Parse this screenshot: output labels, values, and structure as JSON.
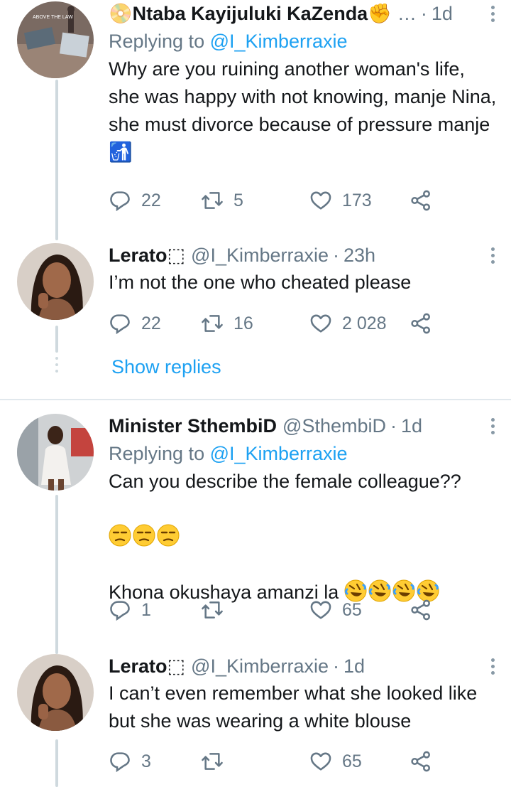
{
  "tweets": [
    {
      "name": "📀Ntaba Kayijuluki KaZenda✊",
      "handle": "…",
      "time": "1d",
      "replying_prefix": "Replying to ",
      "replying_to": "@I_Kimberraxie",
      "text": "Why are you ruining another woman's life, she was happy with not knowing, manje Nina, she must divorce because of pressure manje 🚮",
      "replies": "22",
      "retweets": "5",
      "likes": "173",
      "avatar_caption": "ABOVE THE LAW"
    },
    {
      "name": "Lerato⬚",
      "handle": "@I_Kimberraxie",
      "time": "23h",
      "text": "I’m not the one who cheated please",
      "replies": "22",
      "retweets": "16",
      "likes": "2 028"
    },
    {
      "name": "Minister SthembiD",
      "handle": "@SthembiD",
      "time": "1d",
      "replying_prefix": "Replying to ",
      "replying_to": "@I_Kimberraxie",
      "text_line1": "Can you describe the female colleague??",
      "text_line2": "Khona okushaya amanzi la",
      "replies": "1",
      "retweets": "",
      "likes": "65"
    },
    {
      "name": "Lerato⬚",
      "handle": "@I_Kimberraxie",
      "time": "1d",
      "text": "I can’t even remember what she looked like but she was wearing a white blouse",
      "replies": "3",
      "retweets": "",
      "likes": "65"
    }
  ],
  "show_replies": "Show replies",
  "icons": [
    "reply-icon",
    "retweet-icon",
    "like-icon",
    "share-icon",
    "more-icon"
  ],
  "colors": {
    "link": "#1da1f2",
    "muted": "#657786",
    "line": "#cfd9de"
  }
}
